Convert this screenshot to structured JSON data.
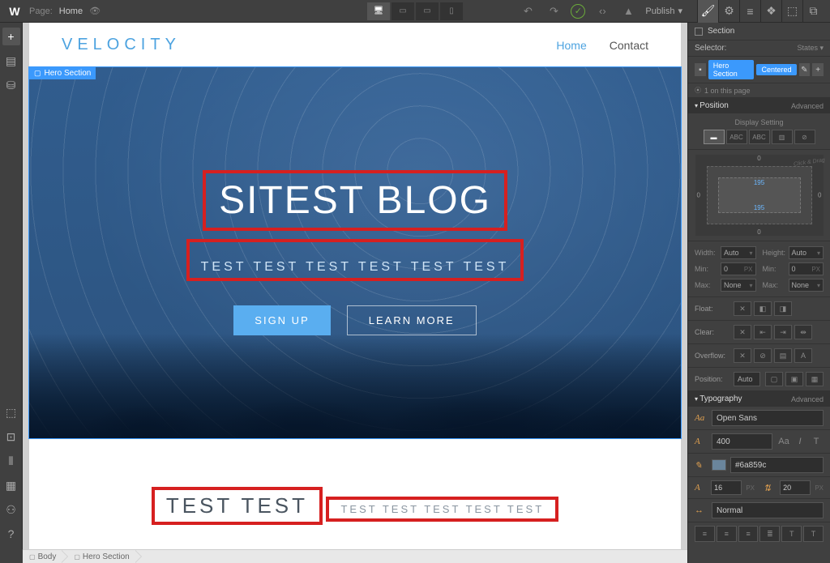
{
  "toolbar": {
    "page_label": "Page:",
    "page_name": "Home",
    "publish": "Publish"
  },
  "selection_tag": "Hero Section",
  "site": {
    "logo": "VELOCITY",
    "nav": {
      "home": "Home",
      "contact": "Contact"
    }
  },
  "hero": {
    "title": "SITEST BLOG",
    "subtitle": "TEST TEST TEST TEST TEST TEST",
    "signup": "SIGN UP",
    "learnmore": "LEARN MORE"
  },
  "below": {
    "title": "TEST TEST",
    "subtitle": "TEST TEST TEST TEST TEST"
  },
  "breadcrumb": {
    "body": "Body",
    "hero": "Hero Section"
  },
  "panel": {
    "section_label": "Section",
    "selector_label": "Selector:",
    "states": "States",
    "tag1": "Hero Section",
    "tag2": "Centered",
    "on_page": "1 on this page",
    "position_hdr": "Position",
    "advanced": "Advanced",
    "display_setting": "Display Setting",
    "box": {
      "margin_top": "0",
      "margin_bottom": "0",
      "margin_left": "0",
      "margin_right": "0",
      "padding_top": "195",
      "padding_bottom": "195",
      "click_drag": "Click & Drag"
    },
    "dims": {
      "width_label": "Width:",
      "width": "Auto",
      "height_label": "Height:",
      "height": "Auto",
      "min_label": "Min:",
      "min_w": "0",
      "min_h": "0",
      "px": "PX",
      "max_label": "Max:",
      "max_w": "None",
      "max_h": "None"
    },
    "float_label": "Float:",
    "clear_label": "Clear:",
    "overflow_label": "Overflow:",
    "position_label": "Position:",
    "position_val": "Auto",
    "typo_hdr": "Typography",
    "font": "Open Sans",
    "weight": "400",
    "style_Aa": "Aa",
    "style_I": "I",
    "style_T": "T",
    "color_hex": "#6a859c",
    "font_size": "16",
    "line_height": "20",
    "letter_spacing": "Normal"
  }
}
